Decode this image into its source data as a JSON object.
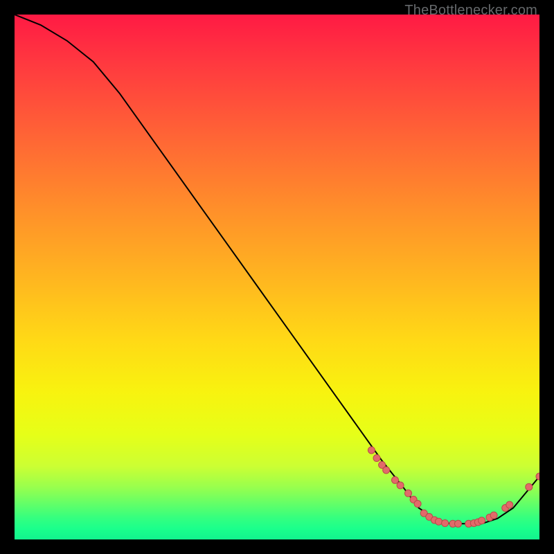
{
  "watermark": "TheBottlenecker.com",
  "chart_data": {
    "type": "line",
    "title": "",
    "xlabel": "",
    "ylabel": "",
    "xlim": [
      0,
      100
    ],
    "ylim": [
      0,
      100
    ],
    "series": [
      {
        "name": "curve",
        "x": [
          0,
          5,
          10,
          15,
          20,
          25,
          30,
          35,
          40,
          45,
          50,
          55,
          60,
          65,
          70,
          74,
          77,
          80,
          83,
          86,
          89,
          92,
          95,
          100
        ],
        "y": [
          100,
          98,
          95,
          91,
          85,
          78,
          71,
          64,
          57,
          50,
          43,
          36,
          29,
          22,
          15,
          10,
          6,
          4,
          3,
          3,
          3,
          4,
          6,
          12
        ],
        "stroke": "#000000",
        "stroke_width": 2
      }
    ],
    "markers": {
      "shape": "circle",
      "fill": "#e26a6a",
      "stroke": "#b94a4a",
      "radius": 5,
      "points": [
        {
          "x": 68,
          "y": 17
        },
        {
          "x": 69,
          "y": 15.5
        },
        {
          "x": 70,
          "y": 14.2
        },
        {
          "x": 70.8,
          "y": 13.2
        },
        {
          "x": 72.5,
          "y": 11.3
        },
        {
          "x": 73.5,
          "y": 10.3
        },
        {
          "x": 75,
          "y": 8.8
        },
        {
          "x": 76,
          "y": 7.6
        },
        {
          "x": 76.8,
          "y": 6.8
        },
        {
          "x": 78,
          "y": 5
        },
        {
          "x": 79,
          "y": 4.3
        },
        {
          "x": 80,
          "y": 3.7
        },
        {
          "x": 80.8,
          "y": 3.4
        },
        {
          "x": 82,
          "y": 3.1
        },
        {
          "x": 83.5,
          "y": 3
        },
        {
          "x": 84.5,
          "y": 3
        },
        {
          "x": 86.5,
          "y": 3
        },
        {
          "x": 87.5,
          "y": 3.1
        },
        {
          "x": 88.3,
          "y": 3.3
        },
        {
          "x": 89,
          "y": 3.6
        },
        {
          "x": 90.5,
          "y": 4.2
        },
        {
          "x": 91.3,
          "y": 4.6
        },
        {
          "x": 93.5,
          "y": 6
        },
        {
          "x": 94.3,
          "y": 6.6
        },
        {
          "x": 98,
          "y": 10
        },
        {
          "x": 100,
          "y": 12
        }
      ]
    }
  }
}
